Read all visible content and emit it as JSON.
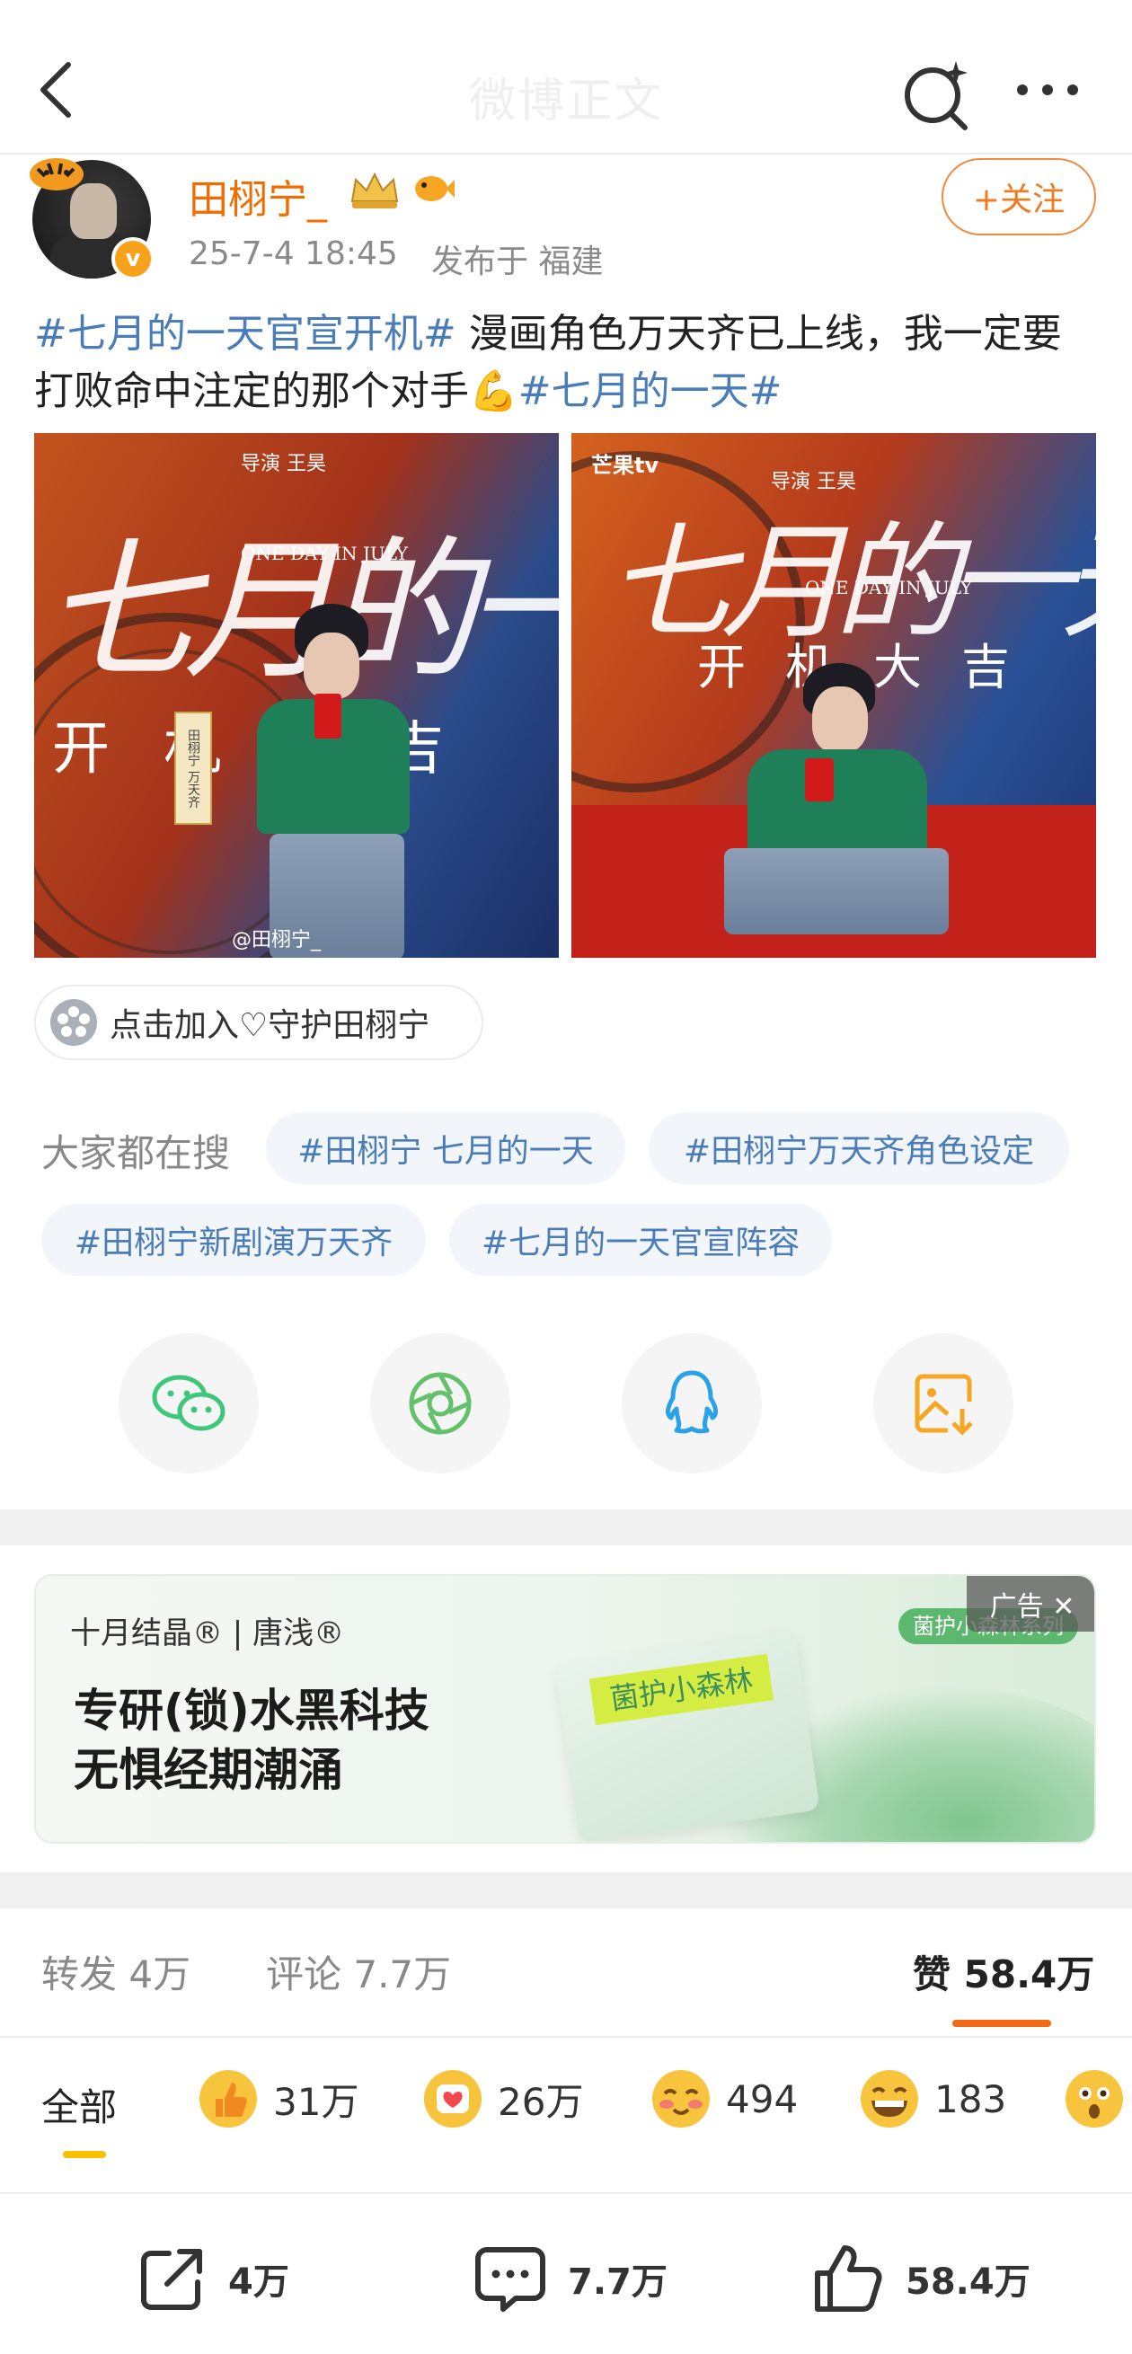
{
  "header": {
    "title": "微博正文"
  },
  "author": {
    "name": "田栩宁_",
    "time": "25-7-4 18:45",
    "location": "发布于 福建",
    "follow_label": "+关注"
  },
  "post": {
    "segments": [
      {
        "text": "#七月的一天官宣开机#",
        "hashtag": true
      },
      {
        "text": " 漫画角色万天齐已上线，我一定要打败命中注定的那个对手💪",
        "hashtag": false
      },
      {
        "text": "#七月的一天#",
        "hashtag": true
      }
    ]
  },
  "photos": [
    {
      "calligraphy": "七月的一天",
      "subtitle_en": "ONE DAY IN JULY",
      "director": "导演 王昊",
      "kaiji": "开机大吉",
      "nameplate": "田栩宁 万天齐",
      "watermark": "@田栩宁_"
    },
    {
      "logo": "芒果tv",
      "calligraphy": "七月的一天",
      "subtitle_en": "ONE DAY IN JULY",
      "director": "导演 王昊",
      "kaiji": "开机大吉"
    }
  ],
  "guard_chip": {
    "label": "点击加入♡守护田栩宁"
  },
  "hot_search": {
    "label": "大家都在搜",
    "tags": [
      "#田栩宁 七月的一天",
      "#田栩宁万天齐角色设定",
      "#田栩宁新剧演万天齐",
      "#七月的一天官宣阵容"
    ]
  },
  "share": {
    "icons": [
      "wechat-icon",
      "moments-icon",
      "qq-icon",
      "save-image-icon"
    ]
  },
  "ad": {
    "brand": "十月结晶® | 唐浅®",
    "line1": "专研(锁)水黑科技",
    "line2": "无惧经期潮涌",
    "pack_label": "菌护小森林",
    "series": "菌护小森林系列",
    "tag": "广告 ✕"
  },
  "stats": {
    "repost": "转发 4万",
    "comment": "评论 7.7万",
    "like": "赞 58.4万"
  },
  "reactions": {
    "all_label": "全部",
    "items": [
      {
        "icon": "thumbs-up-emoji-icon",
        "count": "31万"
      },
      {
        "icon": "heart-emoji-icon",
        "count": "26万"
      },
      {
        "icon": "blush-emoji-icon",
        "count": "494"
      },
      {
        "icon": "grin-emoji-icon",
        "count": "183"
      },
      {
        "icon": "surprised-emoji-icon",
        "count": ""
      }
    ]
  },
  "bottom_bar": {
    "repost": "4万",
    "comment": "7.7万",
    "like": "58.4万"
  },
  "colors": {
    "accent_orange": "#f06c00",
    "hashtag_blue": "#4a7cb8",
    "like_underline": "#f26a16"
  }
}
